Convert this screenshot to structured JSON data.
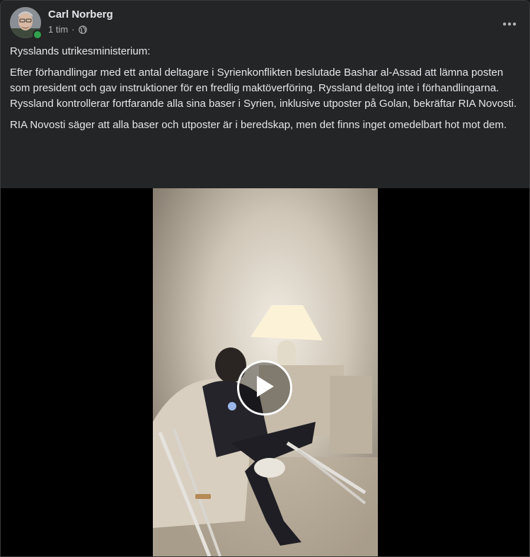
{
  "post": {
    "author": "Carl Norberg",
    "time": "1 tim",
    "separator": "·",
    "paragraphs": [
      "Rysslands utrikesministerium:",
      "Efter förhandlingar med ett antal deltagare i Syrienkonflikten beslutade Bashar al-Assad att lämna posten som president och gav instruktioner för en fredlig maktöverföring. Ryssland deltog inte i förhandlingarna.\nRyssland kontrollerar fortfarande alla sina baser i Syrien, inklusive utposter på Golan, bekräftar RIA Novosti.",
      "RIA Novosti säger att alla baser och utposter är i beredskap, men det finns inget omedelbart hot mot dem."
    ]
  },
  "icons": {
    "audience": "globe-icon",
    "more": "more-horizontal-icon",
    "video": "play-icon"
  },
  "colors": {
    "background": "#242526",
    "text": "#e4e6eb",
    "secondary_text": "#b0b3b8",
    "online": "#31a24c"
  }
}
